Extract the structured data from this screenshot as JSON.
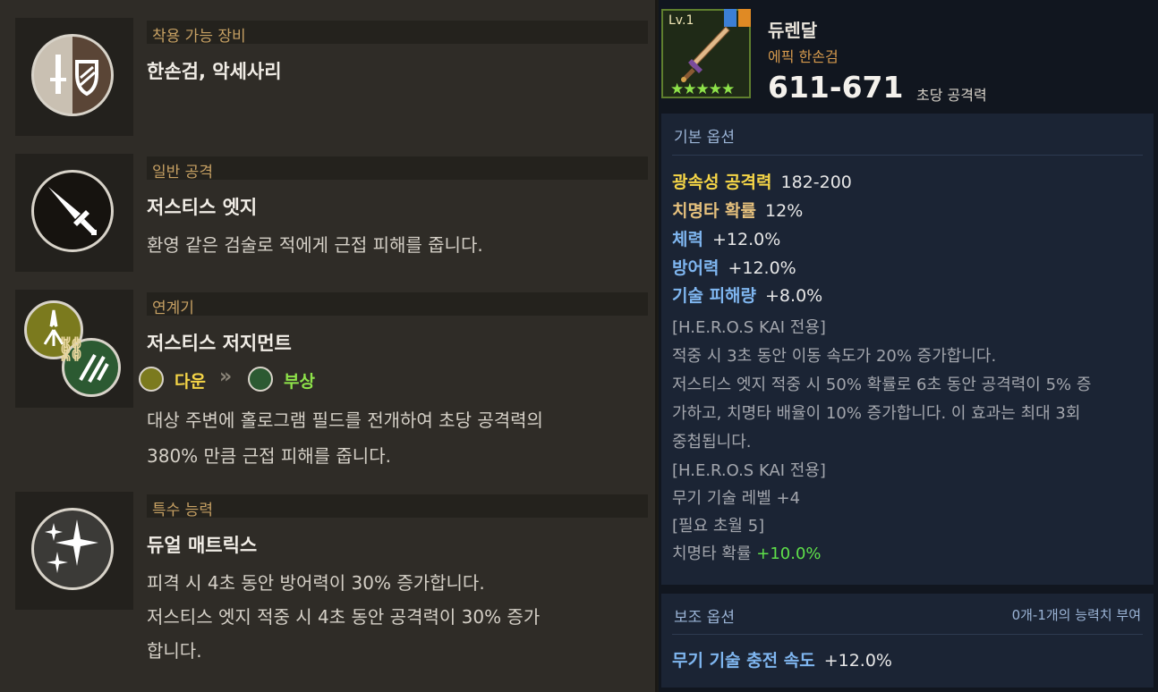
{
  "left": {
    "equip": {
      "header": "착용 가능 장비",
      "title": "한손검, 악세사리"
    },
    "normal_attack": {
      "header": "일반 공격",
      "title": "저스티스 엣지",
      "desc": "환영 같은 검술로 적에게 근접 피해를 줍니다."
    },
    "combo": {
      "header": "연계기",
      "title": "저스티스 저지먼트",
      "tag1": "다운",
      "tag2": "부상",
      "desc1": "대상 주변에 홀로그램 필드를 전개하여 초당 공격력의",
      "desc2": "380% 만큼 근접 피해를 줍니다."
    },
    "special": {
      "header": "특수 능력",
      "title": "듀얼 매트릭스",
      "desc1": "피격 시 4초 동안 방어력이 30% 증가합니다.",
      "desc2": "저스티스 엣지 적중 시 4초 동안 공격력이 30% 증가",
      "desc3": "합니다."
    }
  },
  "item": {
    "level": "Lv.1",
    "stars": "★★★★★",
    "name": "듀렌달",
    "type": "에픽 한손검",
    "attack": "611-671",
    "attack_label": "초당 공격력"
  },
  "basic": {
    "header": "기본 옵션",
    "stats": [
      {
        "label": "광속성 공격력",
        "value": "182-200",
        "color": "#f5d547"
      },
      {
        "label": "치명타 확률",
        "value": "12%",
        "color": "#e5c07d"
      },
      {
        "label": "체력",
        "value": "+12.0%",
        "color": "#7fb6f0"
      },
      {
        "label": "방어력",
        "value": "+12.0%",
        "color": "#7fb6f0"
      },
      {
        "label": "기술 피해량",
        "value": "+8.0%",
        "color": "#7fb6f0"
      }
    ],
    "info": [
      "[H.E.R.O.S KAI 전용]",
      "적중 시 3초 동안 이동 속도가 20% 증가합니다.",
      "저스티스 엣지 적중 시 50% 확률로 6초 동안 공격력이 5% 증",
      "가하고, 치명타 배율이 10% 증가합니다. 이 효과는 최대 3회",
      "중첩됩니다.",
      "[H.E.R.O.S KAI 전용]",
      "무기 기술 레벨 +4",
      "[필요 초월 5]"
    ],
    "crit_label": "치명타 확률",
    "crit_value": "+10.0%"
  },
  "sub": {
    "header": "보조 옵션",
    "note": "0개-1개의 능력치 부여",
    "stat_label": "무기 기술 충전 속도",
    "stat_value": "+12.0%"
  }
}
